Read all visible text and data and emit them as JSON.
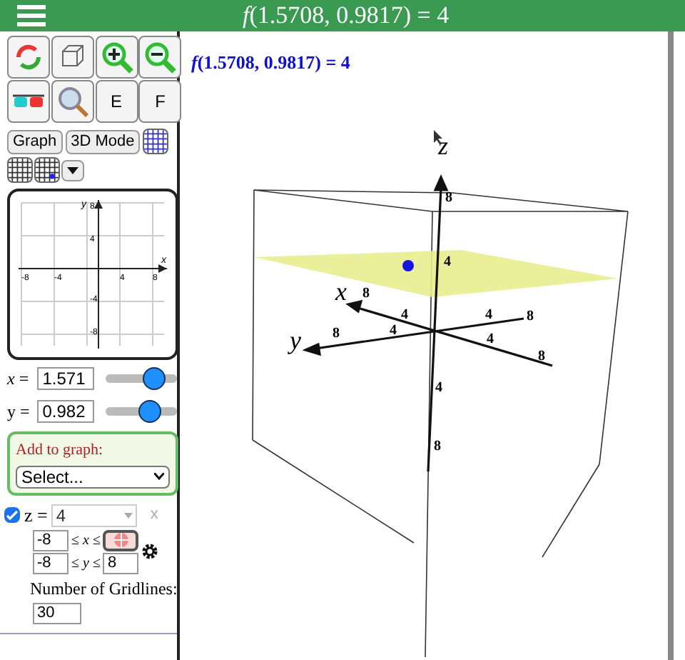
{
  "header": {
    "title": "*f*(1.5708, 0.9817) = 4"
  },
  "toolbar": {
    "letter_buttons": [
      "E",
      "F"
    ],
    "mode_buttons": [
      "Graph",
      "3D Mode"
    ]
  },
  "graph2d": {
    "axis_labels": [
      "x",
      "y"
    ],
    "x_ticks": [
      "-8",
      "-4",
      "4",
      "8"
    ],
    "y_ticks": [
      "8",
      "4",
      "-4",
      "-8"
    ]
  },
  "variables": [
    {
      "label": "*x* =",
      "value": "1.571",
      "level": 0.78
    },
    {
      "label": "y =",
      "value": "0.982",
      "level": 0.68
    }
  ],
  "add_to_graph": {
    "label": "Add to graph:",
    "value": "Select..."
  },
  "function": {
    "checked": true,
    "label": "z =",
    "value": "4",
    "remove": "x",
    "x_min": "-8",
    "x_range_label": "≤ *x* ≤",
    "y_min": "-8",
    "y_range_label": "≤ *y* ≤",
    "y_max": "8",
    "gridlines_label": "Number of Gridlines:",
    "gridlines": "30"
  },
  "canvas": {
    "heading": "*f*(1.5708, 0.9817) = 4",
    "axis_labels": [
      "z",
      "x",
      "y"
    ],
    "tick_labels": [
      "8",
      "4",
      "8",
      "4",
      "8",
      "4",
      "4",
      "8",
      "4",
      "8",
      "4",
      "8"
    ]
  }
}
